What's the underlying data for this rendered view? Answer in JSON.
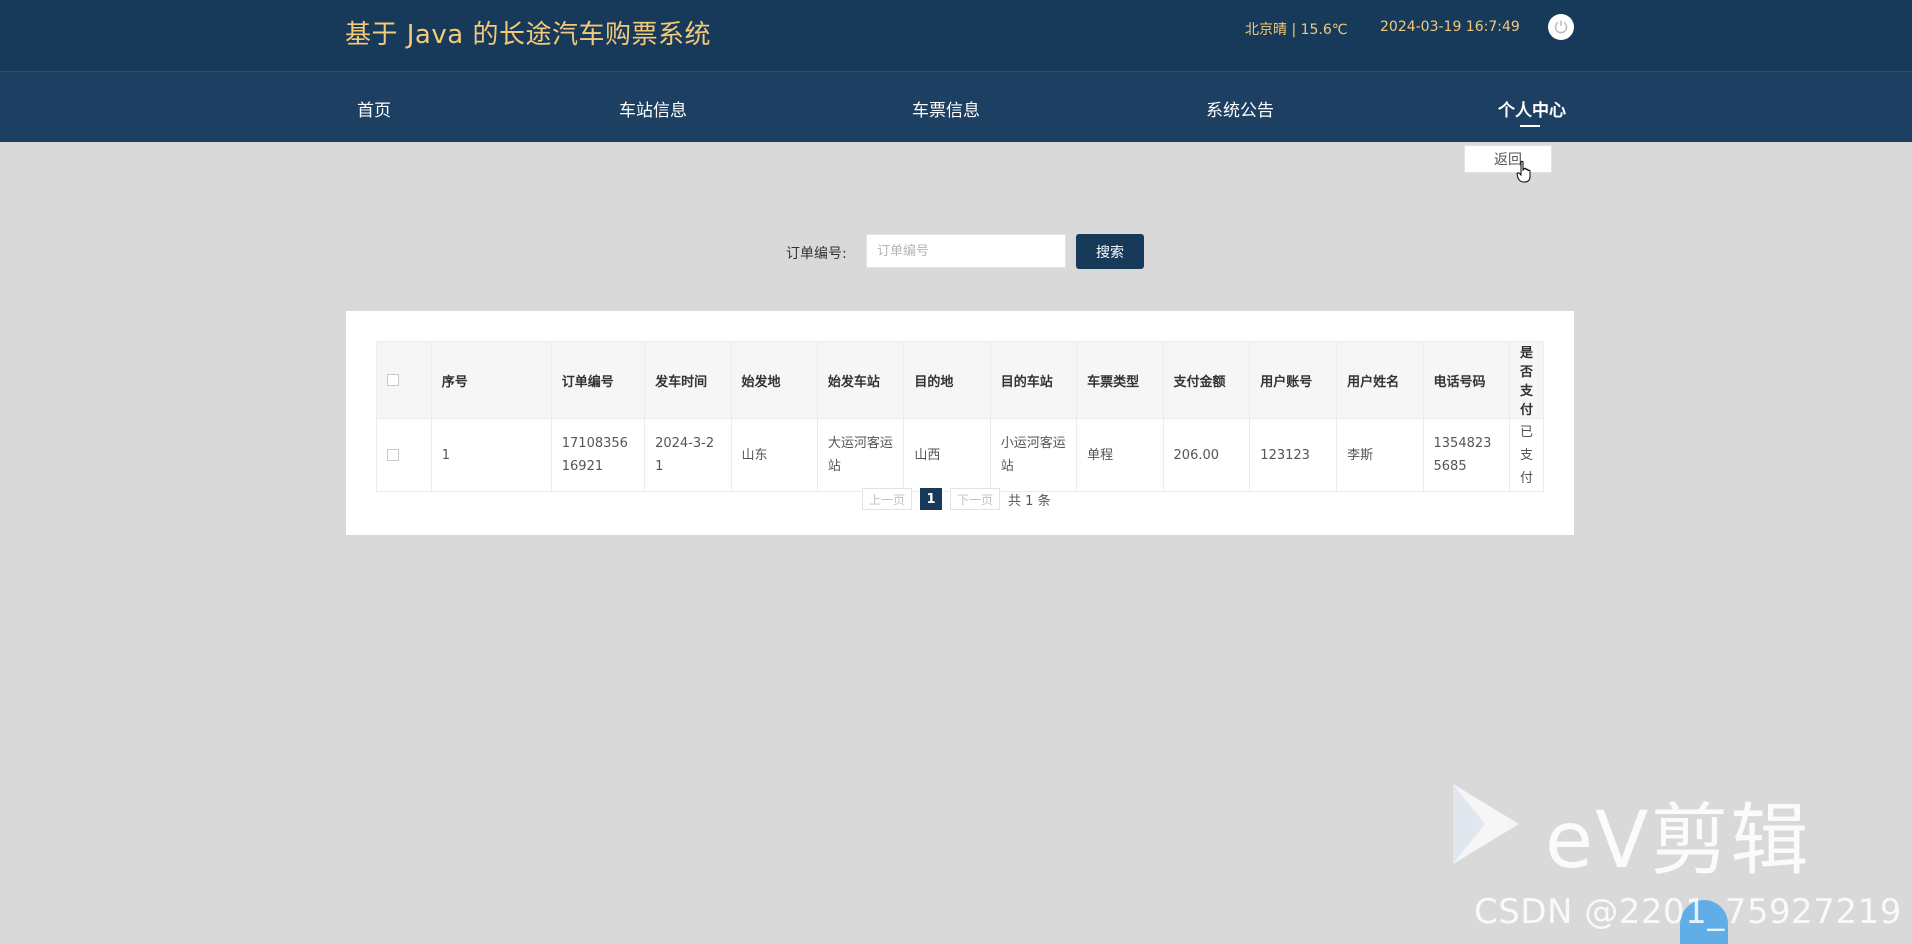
{
  "header": {
    "title": "基于 Java 的长途汽车购票系统",
    "weather": "北京晴 | 15.6℃",
    "datetime": "2024-03-19   16:7:49",
    "title_color": "#f3c97a",
    "bg_color": "#183a5a"
  },
  "nav": {
    "items": [
      {
        "label": "首页"
      },
      {
        "label": "车站信息"
      },
      {
        "label": "车票信息"
      },
      {
        "label": "系统公告"
      },
      {
        "label": "个人中心"
      }
    ],
    "active": "个人中心"
  },
  "back_label": "返回",
  "search": {
    "label": "订单编号:",
    "placeholder": "订单编号",
    "value": "",
    "button": "搜索"
  },
  "table": {
    "columns": [
      "序号",
      "订单编号",
      "发车时间",
      "始发地",
      "始发车站",
      "目的地",
      "目的车站",
      "车票类型",
      "支付金额",
      "用户账号",
      "用户姓名",
      "电话号码",
      "是否支付"
    ],
    "rows": [
      [
        "1",
        "1710835616921",
        "2024-3-21",
        "山东",
        "大运河客运站",
        "山西",
        "小运河客运站",
        "单程",
        "206.00",
        "123123",
        "李斯",
        "13548235685",
        "已支付"
      ]
    ]
  },
  "pager": {
    "prev": "上一页",
    "current": "1",
    "next": "下一页",
    "total": "共 1 条"
  },
  "watermark": {
    "brand": "eV剪辑",
    "credit": "CSDN @2201_75927219"
  }
}
